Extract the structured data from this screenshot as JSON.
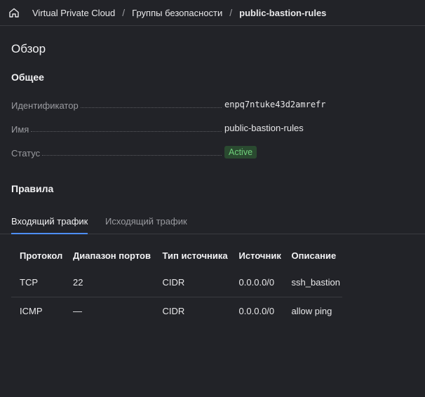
{
  "breadcrumb": {
    "items": [
      "Virtual Private Cloud",
      "Группы безопасности",
      "public-bastion-rules"
    ],
    "separator": "/"
  },
  "overview": {
    "title": "Обзор",
    "general_title": "Общее",
    "properties": {
      "id_label": "Идентификатор",
      "id_value": "enpq7ntuke43d2amrefr",
      "name_label": "Имя",
      "name_value": "public-bastion-rules",
      "status_label": "Статус",
      "status_value": "Active"
    }
  },
  "rules": {
    "title": "Правила",
    "tabs": [
      {
        "label": "Входящий трафик",
        "active": true
      },
      {
        "label": "Исходящий трафик",
        "active": false
      }
    ],
    "columns": [
      "Протокол",
      "Диапазон портов",
      "Тип источника",
      "Источник",
      "Описание"
    ],
    "rows": [
      [
        "TCP",
        "22",
        "CIDR",
        "0.0.0.0/0",
        "ssh_bastion"
      ],
      [
        "ICMP",
        "—",
        "CIDR",
        "0.0.0.0/0",
        "allow ping"
      ]
    ]
  },
  "colors": {
    "background": "#222328",
    "accent": "#4d8ef5",
    "status_active": "#6fcf7a"
  }
}
